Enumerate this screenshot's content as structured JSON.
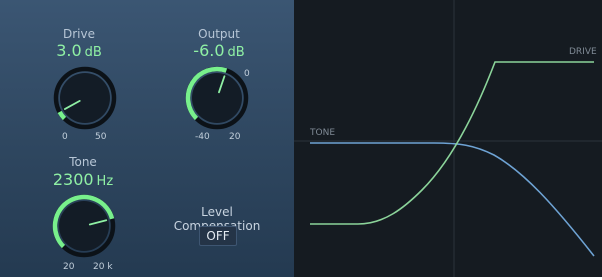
{
  "drive": {
    "label": "Drive",
    "value": "3.0",
    "unit": "dB",
    "range_min": "0",
    "range_max": "50",
    "level": 0.06
  },
  "output": {
    "label": "Output",
    "value": "-6.0",
    "unit": "dB",
    "range_min": "-40",
    "range_mid": "0",
    "range_max": "20",
    "level": 0.57
  },
  "tone": {
    "label": "Tone",
    "value": "2300",
    "unit": "Hz",
    "range_min": "20",
    "range_max": "20 k",
    "level": 0.78
  },
  "level_compensation": {
    "label": "Level Compensation",
    "button": "OFF"
  },
  "graph": {
    "drive_label": "DRIVE",
    "tone_label": "TONE",
    "drive_color": "#8bd49a",
    "tone_color": "#6ea3d4"
  }
}
